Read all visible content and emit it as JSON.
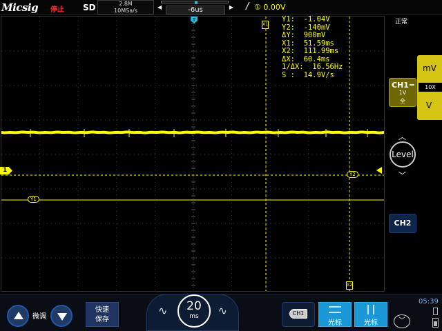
{
  "header": {
    "brand": "Micsig",
    "run_status": "停止",
    "acq_mode": "SD",
    "memory_depth": "2.8M",
    "sample_rate": "10MSa/s",
    "time_offset": "-6us",
    "trigger_source_icon": "①",
    "trigger_level": "0.00V",
    "colors": {
      "run_status": "#ff2a2a",
      "trace": "#ffff00"
    }
  },
  "readout": {
    "y1": "Y1:  -1.04V",
    "y2": "Y2:  -140mV",
    "dy": "ΔY:  900mV",
    "x1": "X1:  51.59ms",
    "x2": "X2:  111.99ms",
    "dx": "ΔX:  60.4ms",
    "inv_dx": "1/ΔX:  16.56Hz",
    "slope": "S :  14.9V/s"
  },
  "markers": {
    "ch1": "1",
    "top_pos": "T",
    "y1_tag": "Y1",
    "y2_tag": "Y2",
    "x1_tag": "X1",
    "x2_tag": "X2"
  },
  "right_panel": {
    "trigger_mode": "正常",
    "unit_top": "mV",
    "probe": "10X",
    "unit_bottom": "V",
    "ch1_name": "CH1",
    "ch1_dash": "━",
    "ch1_scale": "1V",
    "ch1_bw": "全",
    "level_label": "Level",
    "ch2_name": "CH2"
  },
  "bottom": {
    "fine_label": "微调",
    "save_line1": "快速",
    "save_line2": "保存",
    "timebase_value": "20",
    "timebase_unit": "ms",
    "source": "CH1",
    "cursor_h_label": "光标",
    "cursor_v_label": "光标",
    "clock": "05:39"
  }
}
